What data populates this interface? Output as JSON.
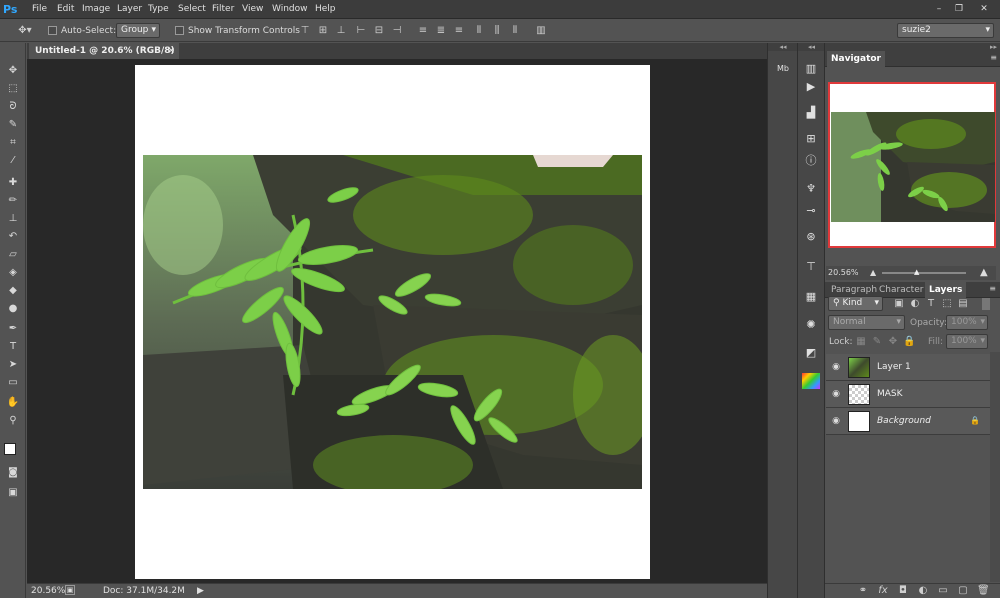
{
  "app": {
    "logo": "Ps"
  },
  "menu": [
    "File",
    "Edit",
    "Image",
    "Layer",
    "Type",
    "Select",
    "Filter",
    "View",
    "Window",
    "Help"
  ],
  "window_controls": {
    "minimize": "–",
    "restore": "❐",
    "close": "✕"
  },
  "options_bar": {
    "auto_select_label": "Auto-Select:",
    "auto_select_value": "Group",
    "show_transform_label": "Show Transform Controls",
    "workspace": "suzie2"
  },
  "document": {
    "tab_title": "Untitled-1 @ 20.6% (RGB/8) *",
    "tab_close": "×"
  },
  "status": {
    "zoom": "20.56%",
    "doc_info": "Doc: 37.1M/34.2M"
  },
  "navigator": {
    "tab": "Navigator",
    "zoom": "20.56%"
  },
  "layers_panel": {
    "tabs": [
      "Paragraph",
      "Character",
      "Layers"
    ],
    "active_tab": "Layers",
    "kind_label": "Kind",
    "blend_mode": "Normal",
    "opacity_label": "Opacity:",
    "opacity_value": "100%",
    "lock_label": "Lock:",
    "fill_label": "Fill:",
    "fill_value": "100%",
    "layers": [
      {
        "name": "Layer 1",
        "thumb": "photo",
        "italic": false,
        "locked": false
      },
      {
        "name": "MASK",
        "thumb": "transparent",
        "italic": false,
        "locked": false
      },
      {
        "name": "Background",
        "thumb": "white",
        "italic": true,
        "locked": true
      }
    ]
  },
  "colors": {
    "accent": "#31a8ff",
    "nav_frame": "#e0393b",
    "canvas_bg": "#282828",
    "panel_bg": "#535353"
  }
}
